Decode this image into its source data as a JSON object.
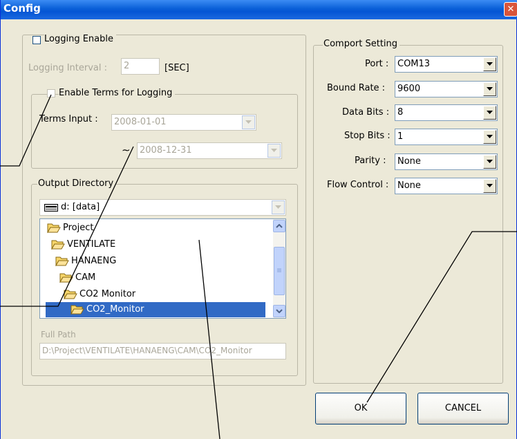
{
  "window": {
    "title": "Config",
    "close_glyph": "✕"
  },
  "logging": {
    "legend": "Logging Enable",
    "interval_label": "Logging Interval :",
    "interval_value": "2",
    "interval_unit": "[SEC]",
    "terms": {
      "legend": "Enable Terms for Logging",
      "input_label": "Terms Input :",
      "start_date": "2008-01-01",
      "tilde": "∼",
      "end_date": "2008-12-31"
    }
  },
  "output": {
    "legend": "Output Directory",
    "drive": "d: [data]",
    "tree": [
      {
        "label": "Project",
        "icon": "open-folder-icon",
        "selected": false
      },
      {
        "label": "VENTILATE",
        "icon": "open-folder-icon",
        "selected": false
      },
      {
        "label": "HANAENG",
        "icon": "open-folder-icon",
        "selected": false
      },
      {
        "label": "CAM",
        "icon": "open-folder-icon",
        "selected": false
      },
      {
        "label": "CO2 Monitor",
        "icon": "open-folder-icon",
        "selected": false
      },
      {
        "label": "CO2_Monitor",
        "icon": "open-folder-icon",
        "selected": true
      }
    ],
    "full_path_label": "Full Path",
    "full_path_value": "D:\\Project\\VENTILATE\\HANAENG\\CAM\\CO2_Monitor"
  },
  "comport": {
    "legend": "Comport Setting",
    "port_label": "Port :",
    "port_value": "COM13",
    "baud_label": "Bound Rate :",
    "baud_value": "9600",
    "databits_label": "Data Bits :",
    "databits_value": "8",
    "stopbits_label": "Stop Bits :",
    "stopbits_value": "1",
    "parity_label": "Parity :",
    "parity_value": "None",
    "flow_label": "Flow Control :",
    "flow_value": "None"
  },
  "buttons": {
    "ok": "OK",
    "cancel": "CANCEL"
  },
  "colors": {
    "titlebar": "#0a5fd8",
    "dialog_bg": "#ece9d8",
    "selection": "#316ac5"
  }
}
